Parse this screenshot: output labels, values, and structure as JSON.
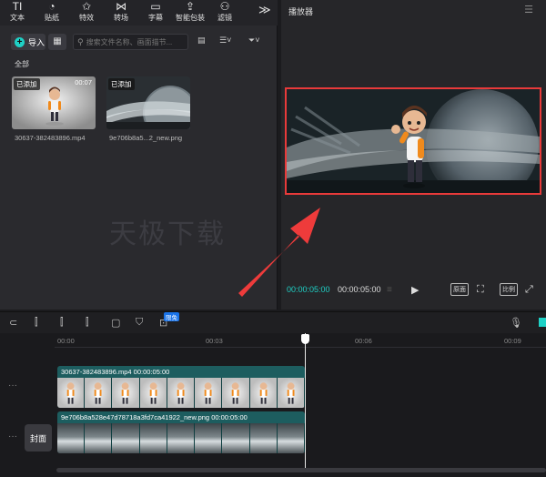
{
  "toolbar": {
    "items": [
      {
        "label": "文本",
        "icon": "text-icon",
        "glyph": "TI"
      },
      {
        "label": "贴纸",
        "icon": "sticker-icon",
        "glyph": "◔"
      },
      {
        "label": "特效",
        "icon": "effects-icon",
        "glyph": "✩"
      },
      {
        "label": "转场",
        "icon": "transition-icon",
        "glyph": "⋈"
      },
      {
        "label": "字幕",
        "icon": "subtitle-icon",
        "glyph": "▭"
      },
      {
        "label": "智能包装",
        "icon": "smart-package-icon",
        "glyph": "⇪"
      },
      {
        "label": "滤镜",
        "icon": "filter-icon",
        "glyph": "⚇"
      }
    ],
    "more_glyph": "≫"
  },
  "media": {
    "import_label": "导入",
    "search_placeholder": "搜索文件名称、画面描节...",
    "section_label": "全部",
    "items": [
      {
        "tag": "已添加",
        "duration": "00:07",
        "name": "30637-382483896.mp4"
      },
      {
        "tag": "已添加",
        "duration": "",
        "name": "9e706b8a5...2_new.png"
      }
    ],
    "watermark": "天极下载"
  },
  "player": {
    "title": "播放器",
    "current_time": "00:00:05:00",
    "total_time": "00:00:05:00",
    "buttons": {
      "original": "原面",
      "ratio": "比例"
    }
  },
  "timeline": {
    "new_badge": "限免",
    "ruler": [
      "00:00",
      "00:03",
      "00:06",
      "00:09"
    ],
    "cover_label": "封面",
    "clips": [
      {
        "name": "30637-382483896.mp4",
        "duration": "00:00:05:00"
      },
      {
        "name": "9e706b8a528e47d78718a3fd7ca41922_new.png",
        "duration": "00:00:05:00"
      }
    ]
  },
  "colors": {
    "accent": "#1fd1c6",
    "highlight_border": "#e83a3a",
    "arrow": "#ee3b3b",
    "clip": "#1d5d5f"
  }
}
